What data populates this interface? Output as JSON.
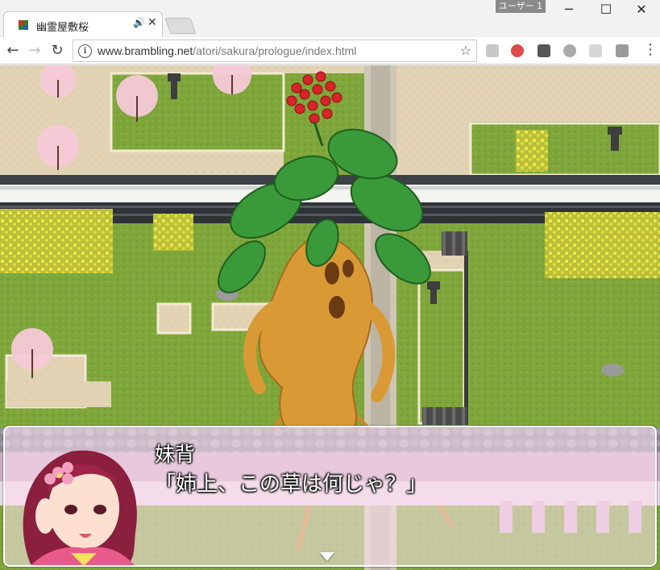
{
  "browser": {
    "tab_title": "幽霊屋敷桜",
    "user_badge": "ユーザー 1",
    "url_domain": "www.brambling.net",
    "url_path": "/atori/sakura/prologue/index.html"
  },
  "game": {
    "speaker_name": "妹背",
    "dialogue_text": "「姉上、この草は何じゃ？」"
  },
  "colors": {
    "grass": "#7fa63b",
    "path": "#e3d3b5",
    "wall_roof": "#3c4147",
    "message_window": "#ffe1f0",
    "rape_blossom": "#e8e24a",
    "mandrake_root": "#d99a36",
    "mandrake_leaves": "#3a9a3a",
    "berries": "#d8232a"
  }
}
